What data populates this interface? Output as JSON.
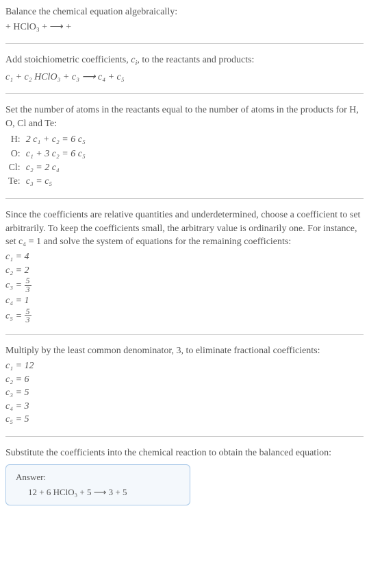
{
  "section1": {
    "line1": "Balance the chemical equation algebraically:",
    "line2": " + HClO₃ +  ⟶  + "
  },
  "section2": {
    "line1_a": "Add stoichiometric coefficients, ",
    "line1_ci": "c",
    "line1_ci_sub": "i",
    "line1_b": ", to the reactants and products:",
    "line2": "c₁  + c₂ HClO₃ + c₃  ⟶ c₄  + c₅"
  },
  "section3": {
    "line1": "Set the number of atoms in the reactants equal to the number of atoms in the products for H, O, Cl and Te:",
    "rows": [
      {
        "el": "H:",
        "eq": "2 c₁ + c₂ = 6 c₅"
      },
      {
        "el": "O:",
        "eq": "c₁ + 3 c₂ = 6 c₅"
      },
      {
        "el": "Cl:",
        "eq": "c₂ = 2 c₄"
      },
      {
        "el": "Te:",
        "eq": "c₃ = c₅"
      }
    ]
  },
  "section4": {
    "line1": "Since the coefficients are relative quantities and underdetermined, choose a coefficient to set arbitrarily. To keep the coefficients small, the arbitrary value is ordinarily one. For instance, set c₄ = 1 and solve the system of equations for the remaining coefficients:",
    "coefs": [
      {
        "lhs": "c₁",
        "rhs": "4"
      },
      {
        "lhs": "c₂",
        "rhs": "2"
      },
      {
        "lhs": "c₃",
        "frac_num": "5",
        "frac_den": "3"
      },
      {
        "lhs": "c₄",
        "rhs": "1"
      },
      {
        "lhs": "c₅",
        "frac_num": "5",
        "frac_den": "3"
      }
    ]
  },
  "section5": {
    "line1": "Multiply by the least common denominator, 3, to eliminate fractional coefficients:",
    "coefs": [
      {
        "lhs": "c₁",
        "rhs": "12"
      },
      {
        "lhs": "c₂",
        "rhs": "6"
      },
      {
        "lhs": "c₃",
        "rhs": "5"
      },
      {
        "lhs": "c₄",
        "rhs": "3"
      },
      {
        "lhs": "c₅",
        "rhs": "5"
      }
    ]
  },
  "section6": {
    "line1": "Substitute the coefficients into the chemical reaction to obtain the balanced equation:",
    "answer_label": "Answer:",
    "answer_eq": "12  + 6 HClO₃ + 5  ⟶ 3  + 5"
  }
}
